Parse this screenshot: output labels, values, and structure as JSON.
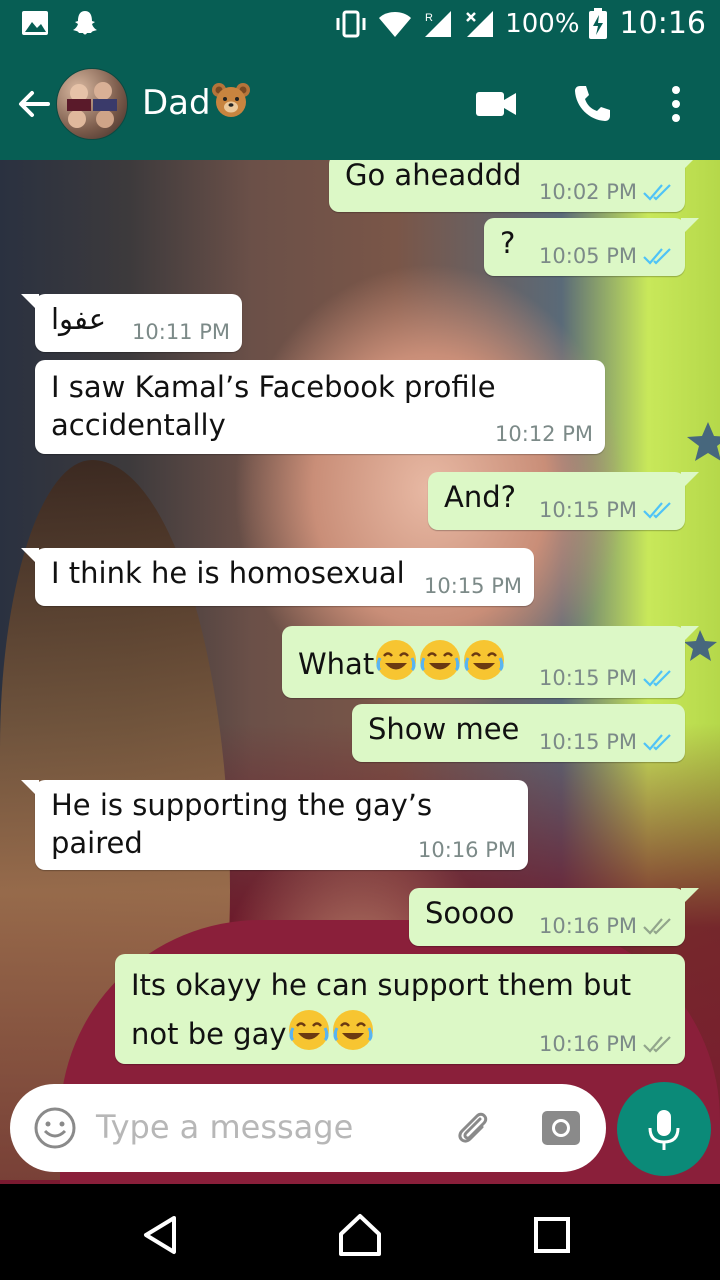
{
  "status_bar": {
    "battery": "100%",
    "time": "10:16",
    "roaming": "R"
  },
  "header": {
    "contact_name": "Dad",
    "contact_emoji": "bear-face"
  },
  "messages": [
    {
      "direction": "out",
      "text": "Go aheaddd",
      "time": "10:02 PM",
      "status": "read"
    },
    {
      "direction": "out",
      "text": "?",
      "time": "10:05 PM",
      "status": "read"
    },
    {
      "direction": "in",
      "text": "عفوا",
      "time": "10:11 PM"
    },
    {
      "direction": "in",
      "text": "I saw Kamal’s Facebook profile",
      "text2": "accidentally",
      "time": "10:12 PM"
    },
    {
      "direction": "out",
      "text": "And?",
      "time": "10:15 PM",
      "status": "read"
    },
    {
      "direction": "in",
      "text": "I think he is homosexual",
      "time": "10:15 PM"
    },
    {
      "direction": "out",
      "text": "What",
      "emoji": "tears-of-joy x3",
      "time": "10:15 PM",
      "status": "read"
    },
    {
      "direction": "out",
      "text": "Show mee",
      "time": "10:15 PM",
      "status": "read"
    },
    {
      "direction": "in",
      "text": "He is supporting the gay’s paired",
      "time": "10:16 PM"
    },
    {
      "direction": "out",
      "text": "Soooo",
      "time": "10:16 PM",
      "status": "delivered"
    },
    {
      "direction": "out",
      "text": "Its okayy he can support them but",
      "text2": "not be gay",
      "emoji": "tears-of-joy x2",
      "time": "10:16 PM",
      "status": "delivered"
    }
  ],
  "input": {
    "placeholder": "Type a message"
  },
  "colors": {
    "header": "#075e54",
    "outgoing_bubble": "#dcf8c6",
    "incoming_bubble": "#ffffff",
    "read_ticks": "#4fc3f7",
    "delivered_ticks": "#92a58c",
    "mic_button": "#0b8a78"
  }
}
